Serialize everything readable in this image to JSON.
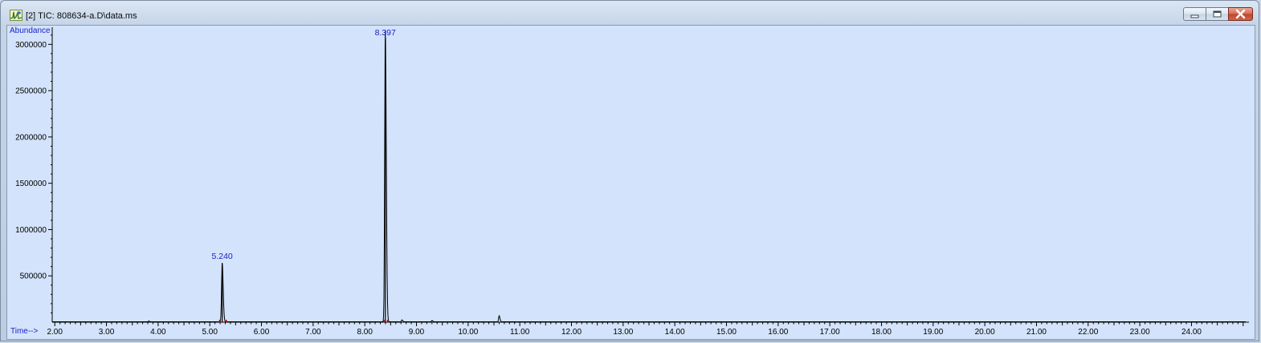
{
  "window": {
    "title": "[2] TIC: 808634-a.D\\data.ms",
    "icon": "chromatogram-app-icon",
    "buttons": [
      "minimize",
      "restore",
      "close"
    ]
  },
  "colors": {
    "plot_background": "#d3e3fb",
    "axis_label_color": "#1a22c8",
    "trace_color": "#000000",
    "baseline_marker_color": "#cc0000"
  },
  "chart_data": {
    "type": "line",
    "ylabel": "Abundance",
    "xlabel": "Time-->",
    "xlim": [
      1.95,
      25.05
    ],
    "ylim": [
      0,
      3150000
    ],
    "x_ticks": [
      "2.00",
      "3.00",
      "4.00",
      "5.00",
      "6.00",
      "7.00",
      "8.00",
      "9.00",
      "10.00",
      "11.00",
      "12.00",
      "13.00",
      "14.00",
      "15.00",
      "16.00",
      "17.00",
      "18.00",
      "19.00",
      "20.00",
      "21.00",
      "22.00",
      "23.00",
      "24.00"
    ],
    "y_ticks": [
      "500000",
      "1000000",
      "1500000",
      "2000000",
      "2500000",
      "3000000"
    ],
    "peaks": [
      {
        "label": "5.240",
        "rt": 5.24,
        "abundance": 640000
      },
      {
        "label": "8.397",
        "rt": 8.397,
        "abundance": 3150000
      }
    ],
    "minor_peaks": [
      {
        "rt": 3.82,
        "abundance": 8000
      },
      {
        "rt": 8.72,
        "abundance": 20000
      },
      {
        "rt": 9.3,
        "abundance": 15000
      },
      {
        "rt": 10.6,
        "abundance": 65000
      }
    ],
    "baseline_markers": [
      5.19,
      5.32,
      8.37,
      8.44
    ]
  }
}
